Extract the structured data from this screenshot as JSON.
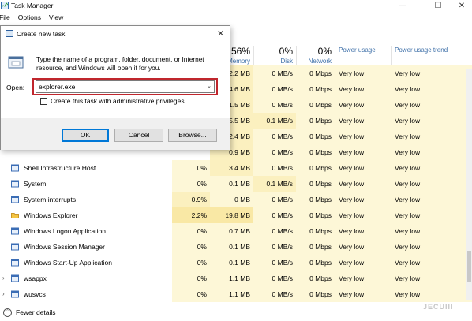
{
  "window": {
    "title": "Task Manager",
    "menu": [
      "File",
      "Options",
      "View"
    ]
  },
  "columns": [
    {
      "pct": "56%",
      "name": "Memory"
    },
    {
      "pct": "0%",
      "name": "Disk"
    },
    {
      "pct": "0%",
      "name": "Network"
    },
    {
      "pct": "",
      "name": "Power usage"
    },
    {
      "pct": "",
      "name": "Power usage trend"
    }
  ],
  "rows": [
    {
      "name": "",
      "cpu": "",
      "mem": "2.2 MB",
      "disk": "0 MB/s",
      "net": "0 Mbps",
      "pu": "Very low",
      "put": "Very low"
    },
    {
      "name": "",
      "cpu": "",
      "mem": "4.6 MB",
      "disk": "0 MB/s",
      "net": "0 Mbps",
      "pu": "Very low",
      "put": "Very low"
    },
    {
      "name": "",
      "cpu": "",
      "mem": "1.5 MB",
      "disk": "0 MB/s",
      "net": "0 Mbps",
      "pu": "Very low",
      "put": "Very low"
    },
    {
      "name": "",
      "cpu": "",
      "mem": "5.5 MB",
      "disk": "0.1 MB/s",
      "net": "0 Mbps",
      "pu": "Very low",
      "put": "Very low"
    },
    {
      "name": "",
      "cpu": "",
      "mem": "2.4 MB",
      "disk": "0 MB/s",
      "net": "0 Mbps",
      "pu": "Very low",
      "put": "Very low"
    },
    {
      "name": "",
      "cpu": "",
      "mem": "0.9 MB",
      "disk": "0 MB/s",
      "net": "0 Mbps",
      "pu": "Very low",
      "put": "Very low"
    },
    {
      "name": "Shell Infrastructure Host",
      "cpu": "0%",
      "mem": "3.4 MB",
      "disk": "0 MB/s",
      "net": "0 Mbps",
      "pu": "Very low",
      "put": "Very low"
    },
    {
      "name": "System",
      "cpu": "0%",
      "mem": "0.1 MB",
      "disk": "0.1 MB/s",
      "net": "0 Mbps",
      "pu": "Very low",
      "put": "Very low"
    },
    {
      "name": "System interrupts",
      "cpu": "0.9%",
      "mem": "0 MB",
      "disk": "0 MB/s",
      "net": "0 Mbps",
      "pu": "Very low",
      "put": "Very low"
    },
    {
      "name": "Windows Explorer",
      "cpu": "2.2%",
      "mem": "19.8 MB",
      "disk": "0 MB/s",
      "net": "0 Mbps",
      "pu": "Very low",
      "put": "Very low"
    },
    {
      "name": "Windows Logon Application",
      "cpu": "0%",
      "mem": "0.7 MB",
      "disk": "0 MB/s",
      "net": "0 Mbps",
      "pu": "Very low",
      "put": "Very low"
    },
    {
      "name": "Windows Session Manager",
      "cpu": "0%",
      "mem": "0.1 MB",
      "disk": "0 MB/s",
      "net": "0 Mbps",
      "pu": "Very low",
      "put": "Very low"
    },
    {
      "name": "Windows Start-Up Application",
      "cpu": "0%",
      "mem": "0.1 MB",
      "disk": "0 MB/s",
      "net": "0 Mbps",
      "pu": "Very low",
      "put": "Very low"
    },
    {
      "name": "wsappx",
      "cpu": "0%",
      "mem": "1.1 MB",
      "disk": "0 MB/s",
      "net": "0 Mbps",
      "pu": "Very low",
      "put": "Very low"
    },
    {
      "name": "wusvcs",
      "cpu": "0%",
      "mem": "1.1 MB",
      "disk": "0 MB/s",
      "net": "0 Mbps",
      "pu": "Very low",
      "put": "Very low"
    }
  ],
  "footer": {
    "fewer_details": "Fewer details",
    "watermark": "JECUIII"
  },
  "dialog": {
    "title": "Create new task",
    "description": "Type the name of a program, folder, document, or Internet resource, and Windows will open it for you.",
    "open_label": "Open:",
    "open_value": "explorer.exe",
    "admin_label": "Create this task with administrative privileges.",
    "ok": "OK",
    "cancel": "Cancel",
    "browse": "Browse..."
  },
  "colors": {
    "accent": "#0078d7",
    "highlight": "#c0262d",
    "heat_light": "#fdf7d7",
    "heat_dark": "#f9e8a5"
  }
}
